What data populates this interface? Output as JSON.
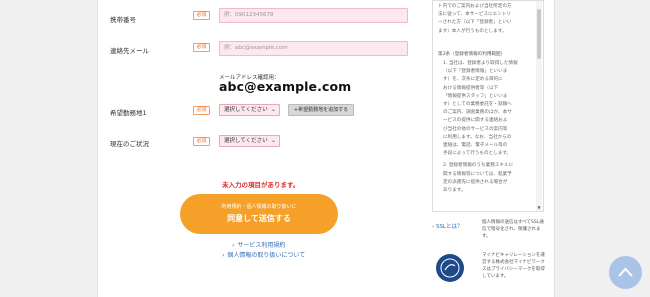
{
  "form": {
    "phone": {
      "label": "携帯番号",
      "required": "必須",
      "placeholder": "例：09012345678"
    },
    "email": {
      "label": "連絡先メール",
      "required": "必須",
      "placeholder": "例：abc@example.com",
      "confirm_label": "メールアドレス確認用：",
      "confirm_value": "abc@example.com"
    },
    "location": {
      "label": "希望勤務地1",
      "required": "必須",
      "select_value": "選択してください",
      "add_button": "+希望勤務地を追加する"
    },
    "status": {
      "label": "現在のご状況",
      "required": "必須",
      "select_value": "選択してください"
    },
    "error_message": "未入力の項目があります。",
    "submit": {
      "sub_label": "利用規約・個人情報の取り扱いに",
      "main_label": "同意して送信する"
    },
    "links": {
      "terms": "サービス利用規約",
      "privacy": "個人情報の取り扱いについて"
    }
  },
  "sidebar": {
    "top_text": [
      "ト内でのご案内および当社所定の方",
      "法に従って、本サービスにエントリ",
      "ーされた方（以下「登録者」といい",
      "ます）本人が行うものとします。"
    ],
    "section_title": "第3条（登録者情報の利用範囲）",
    "section_text": [
      "1. 当社は、登録者より取得した情報",
      "（以下「登録者情報」といいま",
      "す）を、次条に定める目的に",
      "おける情報提供者等（以下",
      "「情報提供スタッフ」といいま",
      "す）としての業務委託を・就職へ",
      "のご案内、調査業務のほか、本サ",
      "ービスの提供に関する連絡およ",
      "び当社の他のサービスの案内等",
      "に利用します。なお、当社からの",
      "連絡は、電話、電子メール等の",
      "手段によって行うものとします。",
      "",
      "2. 登録者情報のうち業務スキルに",
      "関する情報等については、就業予",
      "定の派遣先に提供される場合が",
      "あります。"
    ],
    "ssl_label": "SSLとは？",
    "ssl_desc": "個人情報の送信はすべてSSL通信で暗号化され、保護されます。",
    "privacy_mark": "privacy-mark",
    "privacy_desc": "マイナビキャリレーションを運営する株式会社マイナビワークスはプライバシーマークを取得しています。"
  },
  "icons": {
    "scroll_top": "chevron-up-icon"
  },
  "colors": {
    "accent": "#f5a028",
    "error": "#e02a2a",
    "link": "#2f6db5",
    "field_bg": "#fde8ee"
  }
}
